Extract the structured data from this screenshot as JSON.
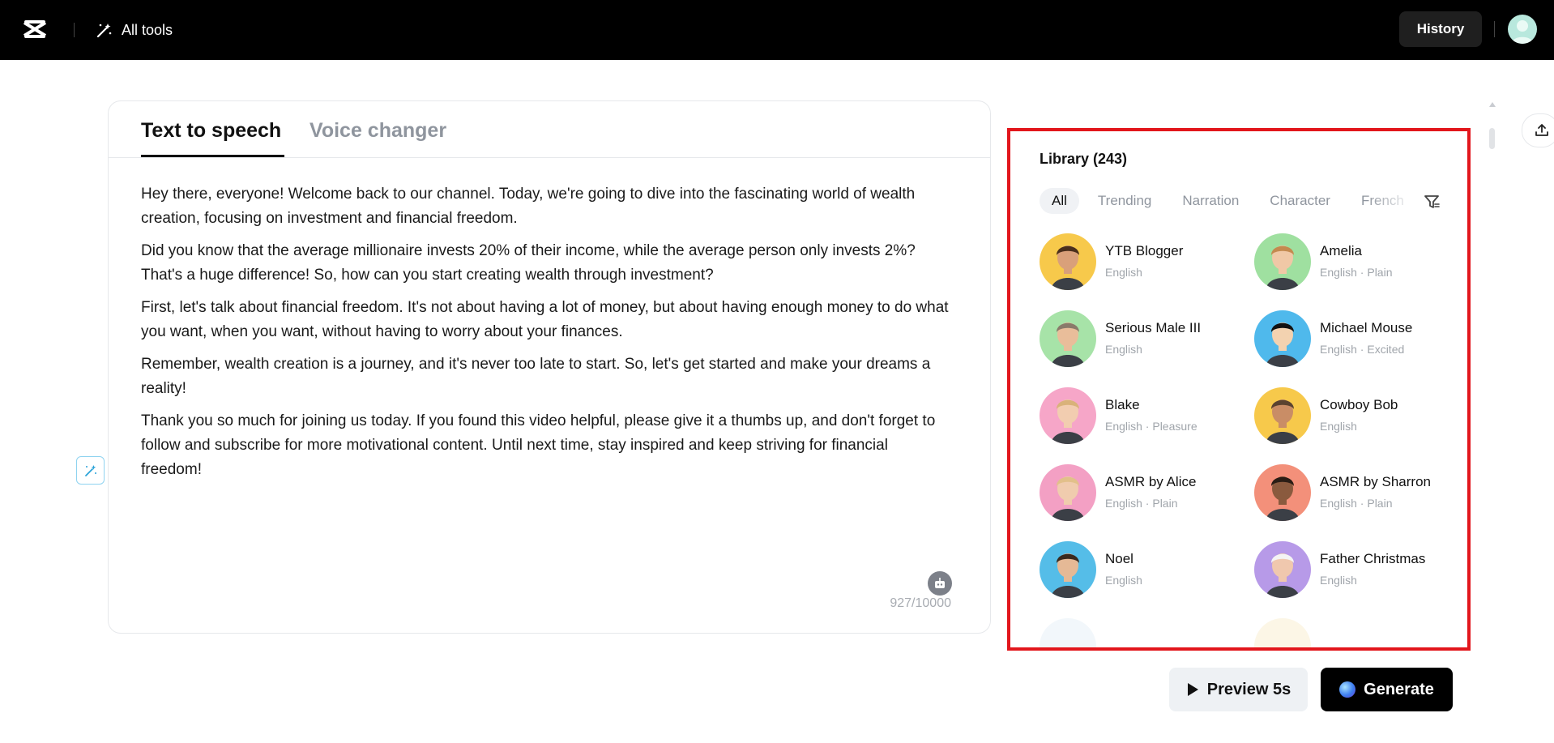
{
  "header": {
    "all_tools_label": "All tools",
    "history_label": "History"
  },
  "editor": {
    "tabs": [
      {
        "label": "Text to speech",
        "active": true
      },
      {
        "label": "Voice changer",
        "active": false
      }
    ],
    "paragraphs": [
      "Hey there, everyone! Welcome back to our channel. Today, we're going to dive into the fascinating world of wealth creation, focusing on investment and financial freedom.",
      "Did you know that the average millionaire invests 20% of their income, while the average person only invests 2%? That's a huge difference! So, how can you start creating wealth through investment?",
      "First, let's talk about financial freedom. It's not about having a lot of money, but about having enough money to do what you want, when you want, without having to worry about your finances.",
      "Remember, wealth creation is a journey, and it's never too late to start. So, let's get started and make your dreams a reality!",
      "Thank you so much for joining us today. If you found this video helpful, please give it a thumbs up, and don't forget to follow and subscribe for more motivational content. Until next time, stay inspired and keep striving for financial freedom!"
    ],
    "char_count": "927/10000"
  },
  "library": {
    "title": "Library (243)",
    "chips": [
      {
        "label": "All",
        "active": true
      },
      {
        "label": "Trending",
        "active": false
      },
      {
        "label": "Narration",
        "active": false
      },
      {
        "label": "Character",
        "active": false
      },
      {
        "label": "French",
        "active": false
      }
    ],
    "voices": [
      {
        "name": "YTB Blogger",
        "meta": "English",
        "bg": "#f7c94b",
        "skin": "#d9a07a",
        "hair": "#4a2f1c"
      },
      {
        "name": "Amelia",
        "meta": "English · Plain",
        "bg": "#9fe0a0",
        "skin": "#f0c8a6",
        "hair": "#c48a4f"
      },
      {
        "name": "Serious Male III",
        "meta": "English",
        "bg": "#a7e3a8",
        "skin": "#e9bd9a",
        "hair": "#8a7a6a"
      },
      {
        "name": "Michael Mouse",
        "meta": "English · Excited",
        "bg": "#4fb9ec",
        "skin": "#f3d2b0",
        "hair": "#111111"
      },
      {
        "name": "Blake",
        "meta": "English · Pleasure",
        "bg": "#f6a6c8",
        "skin": "#f2cdb0",
        "hair": "#d9b27a"
      },
      {
        "name": "Cowboy Bob",
        "meta": "English",
        "bg": "#f7c94b",
        "skin": "#c98d66",
        "hair": "#5a4330"
      },
      {
        "name": "ASMR by Alice",
        "meta": "English · Plain",
        "bg": "#f3a0c4",
        "skin": "#f0ccae",
        "hair": "#e2c08a"
      },
      {
        "name": "ASMR by Sharron",
        "meta": "English · Plain",
        "bg": "#f3907a",
        "skin": "#8a5a3e",
        "hair": "#2a1d15"
      },
      {
        "name": "Noel",
        "meta": "English",
        "bg": "#55bde8",
        "skin": "#e5b996",
        "hair": "#3a2a1e"
      },
      {
        "name": "Father Christmas",
        "meta": "English",
        "bg": "#b79ae8",
        "skin": "#f0c8ae",
        "hair": "#f4f4f4"
      }
    ]
  },
  "actions": {
    "preview_label": "Preview 5s",
    "generate_label": "Generate"
  }
}
